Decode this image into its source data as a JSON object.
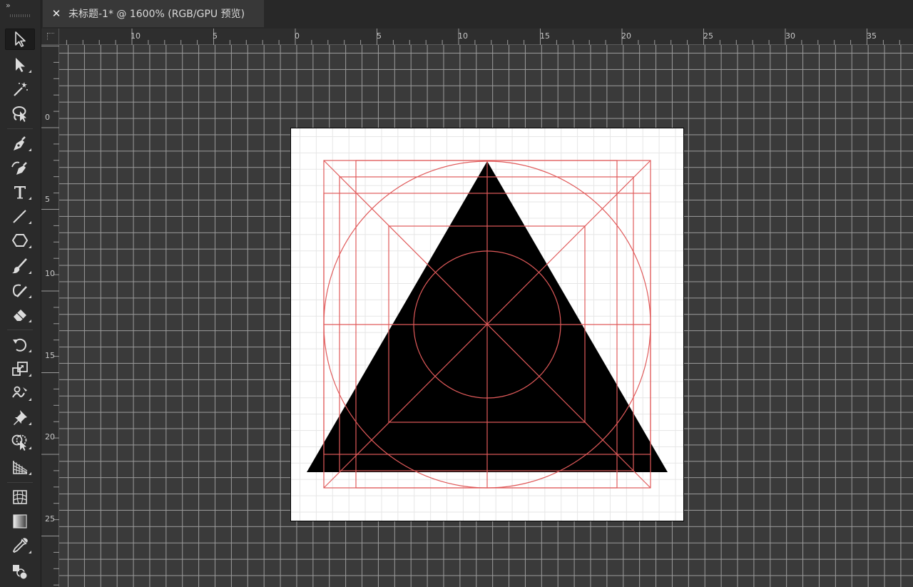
{
  "toolbar": {
    "collapse_label": "››",
    "tools": [
      {
        "name": "selection-tool",
        "icon": "selection-arrow-icon",
        "active": true
      },
      {
        "name": "direct-selection-tool",
        "icon": "direct-selection-arrow-icon"
      },
      {
        "name": "magic-wand-tool",
        "icon": "magic-wand-icon"
      },
      {
        "name": "lasso-tool",
        "icon": "lasso-icon"
      },
      {
        "name": "pen-tool",
        "icon": "pen-icon"
      },
      {
        "name": "curvature-tool",
        "icon": "curvature-pen-icon"
      },
      {
        "name": "type-tool",
        "icon": "type-icon"
      },
      {
        "name": "line-segment-tool",
        "icon": "line-segment-icon"
      },
      {
        "name": "polygon-tool",
        "icon": "polygon-icon"
      },
      {
        "name": "paintbrush-tool",
        "icon": "paintbrush-icon"
      },
      {
        "name": "shaper-tool",
        "icon": "shaper-icon"
      },
      {
        "name": "eraser-tool",
        "icon": "eraser-icon"
      },
      {
        "name": "rotate-tool",
        "icon": "rotate-icon"
      },
      {
        "name": "scale-tool",
        "icon": "scale-icon"
      },
      {
        "name": "warp-tool",
        "icon": "warp-icon"
      },
      {
        "name": "puppet-warp-tool",
        "icon": "pushpin-icon"
      },
      {
        "name": "shape-builder-tool",
        "icon": "shape-builder-icon"
      },
      {
        "name": "perspective-grid-tool",
        "icon": "perspective-grid-icon"
      },
      {
        "name": "mesh-tool",
        "icon": "mesh-icon"
      },
      {
        "name": "gradient-tool",
        "icon": "gradient-icon"
      },
      {
        "name": "eyedropper-tool",
        "icon": "eyedropper-icon"
      },
      {
        "name": "blend-tool",
        "icon": "blend-icon"
      }
    ]
  },
  "document": {
    "tab_close": "✕",
    "tab_title": "未标题-1* @ 1600% (RGB/GPU 预览)"
  },
  "rulers": {
    "horizontal_labels": [
      "10",
      "5",
      "0",
      "5",
      "10",
      "15",
      "20",
      "25",
      "30",
      "35"
    ],
    "vertical_labels": [
      "0",
      "5",
      "10",
      "15",
      "20",
      "25"
    ]
  },
  "artwork": {
    "shape": "filled-triangle",
    "fill_color": "#000000",
    "guide_color": "#e05a5a",
    "artboard_color": "#ffffff"
  },
  "colors": {
    "ui_background": "#323232",
    "canvas_grid": "#9c9c9c",
    "artboard_grid": "#e6e6e6"
  }
}
